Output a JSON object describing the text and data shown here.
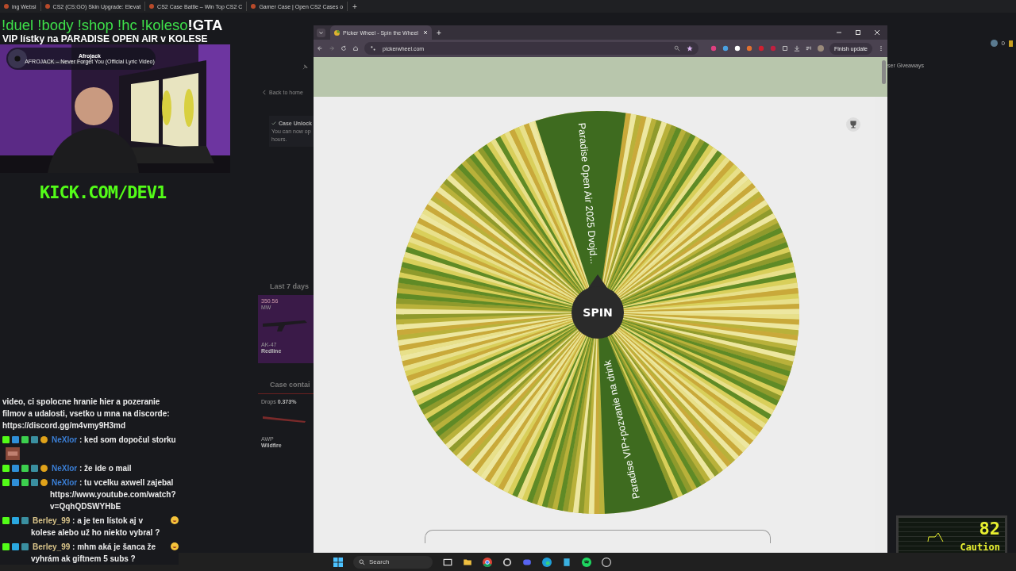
{
  "background_browser": {
    "tabs": [
      {
        "title": "ing Websi"
      },
      {
        "title": "CS2 (CS:GO) Skin Upgrade: Elevat"
      },
      {
        "title": "CS2 Case Battle – Win Top CS2 C"
      },
      {
        "title": "Gamer Case | Open CS2 Cases o"
      }
    ],
    "new_tab": "+",
    "page": {
      "back_link": "Back to home",
      "notice_title": "Case Unlock",
      "notice_text": "You can now op",
      "notice_text_2": "hours.",
      "last_days_heading": "Last 7 days",
      "drop_card": {
        "price": "350.56",
        "wear": "MW",
        "weapon": "AK-47",
        "skin": "Redline"
      },
      "contents_heading": "Case contai",
      "item": {
        "drops_label": "Drops",
        "drops_value": "0.373%",
        "weapon": "AWP",
        "skin": "Wildfire"
      },
      "giveaways": "ser Giveaways",
      "coins": "0"
    }
  },
  "overlay": {
    "commands": "!duel !body !shop !hc !koleso",
    "command_highlight": "!GTA",
    "banner": "VIP lístky na PARADISE OPEN AIR v KOLESE",
    "now_playing": {
      "artist": "Afrojack",
      "track": "AFROJACK – Never Forget You (Official Lyric Video)"
    },
    "channel": "KICK.COM/DEV1"
  },
  "chat": [
    {
      "kind": "text",
      "text": "video, ci spolocne hranie hier a pozeranie filmov a udalosti, vsetko u mna na discorde: https://discord.gg/m4vmy9H3md"
    },
    {
      "kind": "mod",
      "user": "NeXlor",
      "color": "#3b7fd6",
      "text": ": ked som dopočul storku",
      "emote": true,
      "emoji": false
    },
    {
      "kind": "mod",
      "user": "NeXlor",
      "color": "#3b7fd6",
      "text": ": že ide o mail",
      "emote": false,
      "emoji": false
    },
    {
      "kind": "mod",
      "user": "NeXlor",
      "color": "#3b7fd6",
      "text": ": tu vcelku axwell zajebal https://www.youtube.com/watch?v=QqhQDSWYHbE",
      "emote": false,
      "emoji": false
    },
    {
      "kind": "sub",
      "user": "Berley_99",
      "color": "#d9c48a",
      "text": ": a je ten lístok aj v kolese alebo už ho niekto vybral ?",
      "emote": false,
      "emoji": true
    },
    {
      "kind": "sub",
      "user": "Berley_99",
      "color": "#d9c48a",
      "text": ": mhm aká je šanca že vyhrám ak giftnem 5 subs ?",
      "emote": false,
      "emoji": true
    }
  ],
  "browser": {
    "tab_title": "Picker Wheel - Spin the Wheel",
    "new_tab": "+",
    "url": "pickerwheel.com",
    "update_button": "Finish update",
    "wheel_labels": [
      "Paradise Open Air 2025 Dvojd...",
      "Paradise VIP+pozvanie na drink"
    ],
    "spin": "SPIN"
  },
  "taskbar": {
    "search_placeholder": "Search"
  },
  "meter": {
    "value": "82",
    "label": "Caution"
  }
}
